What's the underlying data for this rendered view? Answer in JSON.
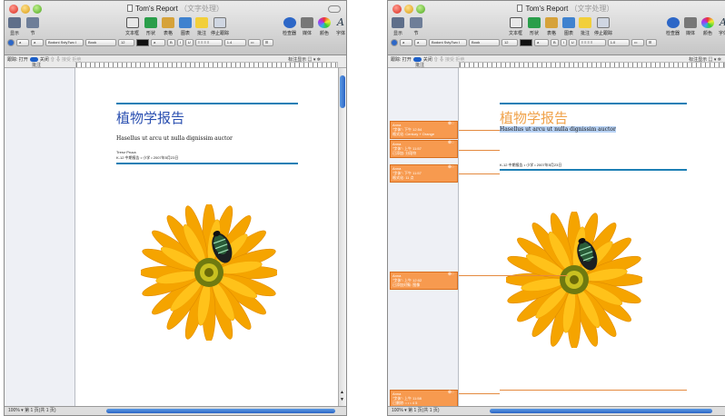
{
  "window_title": "Tom's Report",
  "window_subtitle": "（文字处理）",
  "toolbar": {
    "left": [
      "显示",
      "节"
    ],
    "center": [
      "文本框",
      "形状",
      "表格",
      "图表",
      "批注",
      "停止跟踪"
    ],
    "right": [
      "检查器",
      "媒体",
      "颜色",
      "字体"
    ]
  },
  "format_bar": {
    "style": "a",
    "list": "a",
    "font": "Bodoni SvtyTwo I",
    "typeface": "Book",
    "size": "12",
    "char_color": "a",
    "bold": "B",
    "italic": "I",
    "underline": "U",
    "spacing": "1.4",
    "spacing2": "1.0"
  },
  "tracking_bar": {
    "label": "跟踪:",
    "toggle": "打开",
    "state": "关闭",
    "accept": "接受",
    "reject": "拒绝",
    "show_markup": "标注显示",
    "comments_header": "批注"
  },
  "document": {
    "title": "植物学报告",
    "subtitle": "Hasellus ut arcu ut nulla dignissim auctor",
    "author": "Trenz Pruca",
    "info": "K-12 中期报告 • 小学 • 2007年5月23日"
  },
  "comments": [
    {
      "author": "Anna",
      "line1": "\"字体\": 下午 12:54",
      "line2": "格式化: Century + Orange"
    },
    {
      "author": "Anna",
      "line1": "\"字体\": 上午 11:57",
      "line2": "已添加: 分段符"
    },
    {
      "author": "Anna",
      "line1": "\"字体\": 下午 11:57",
      "line2": "格式化: 11 点"
    },
    {
      "author": "Anna",
      "line1": "\"字体\": 上午 12:02",
      "line2": "已添加对象: 图像"
    },
    {
      "author": "Anna",
      "line1": "\"字体\": 上午 11:58",
      "line2": "已删除: • • • 4 5"
    }
  ],
  "status": {
    "zoom": "100%",
    "page_info_left": "第 1 页(共 1 页)",
    "page_info_right": "第 1 页(共 1 页)"
  },
  "colors": {
    "title_blue": "#2a4fb0",
    "title_orange": "#f0a24a",
    "rule_blue": "#1d7fb5",
    "comment_orange": "#f79a4f"
  }
}
